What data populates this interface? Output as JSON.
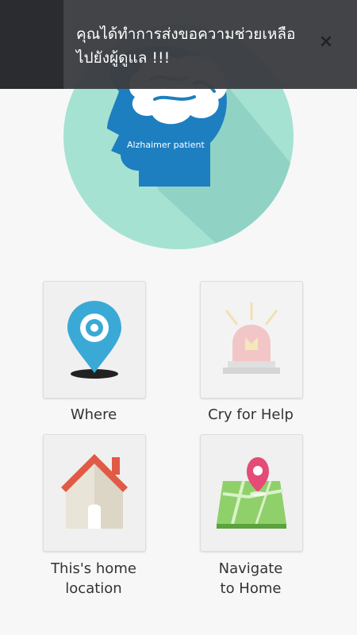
{
  "toast": {
    "message": "คุณได้ทำการส่งขอความช่วยเหลือไปยังผู้ดูแล !!!",
    "close_label": "×"
  },
  "hero": {
    "caption": "Alzhaimer patient"
  },
  "menu": {
    "items": [
      {
        "label": "Where",
        "icon": "location-pin-icon"
      },
      {
        "label": "Cry for Help",
        "icon": "siren-icon"
      },
      {
        "label_line1": "This's home",
        "label_line2": "location",
        "icon": "house-icon"
      },
      {
        "label_line1": "Navigate",
        "label_line2": "to Home",
        "icon": "map-pin-icon"
      }
    ]
  },
  "colors": {
    "hero_circle": "#a6e2d2",
    "head": "#1d7fc0",
    "pin": "#3aa9d6",
    "siren": "#f2a3a3",
    "house_roof": "#e05a45",
    "map": "#8fd06b",
    "toast_bg": "#3c3e42"
  }
}
